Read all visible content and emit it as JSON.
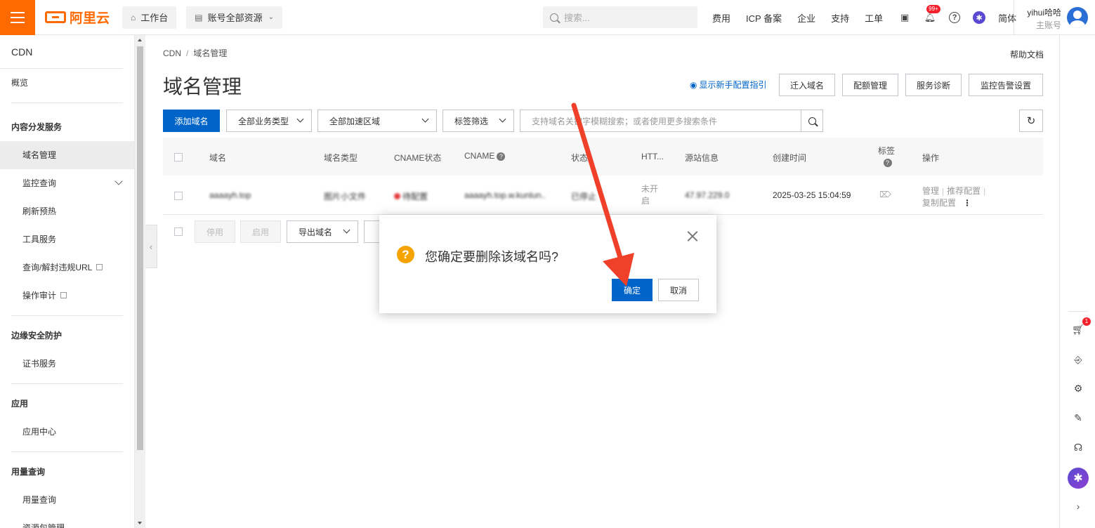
{
  "topbar": {
    "brand": "阿里云",
    "workbench": "工作台",
    "resource_scope": "账号全部资源",
    "search_placeholder": "搜索...",
    "links": [
      "费用",
      "ICP 备案",
      "企业",
      "支持",
      "工单"
    ],
    "notification_badge": "99+",
    "language": "简体",
    "user_name": "yihui哈哈",
    "user_role": "主账号"
  },
  "sidebar": {
    "title": "CDN",
    "overview": "概览",
    "groups": [
      {
        "label": "内容分发服务",
        "items": [
          "域名管理",
          "监控查询",
          "刷新预热",
          "工具服务",
          "查询/解封违规URL",
          "操作审计"
        ]
      },
      {
        "label": "边缘安全防护",
        "items": [
          "证书服务"
        ]
      },
      {
        "label": "应用",
        "items": [
          "应用中心"
        ]
      },
      {
        "label": "用量查询",
        "items": [
          "用量查询",
          "资源包管理"
        ]
      }
    ]
  },
  "main": {
    "breadcrumb": [
      "CDN",
      "域名管理"
    ],
    "help_doc": "帮助文档",
    "title": "域名管理",
    "guide_link": "显示新手配置指引",
    "top_buttons": [
      "迁入域名",
      "配额管理",
      "服务诊断",
      "监控告警设置"
    ],
    "add_domain": "添加域名",
    "filters": [
      "全部业务类型",
      "全部加速区域",
      "标签筛选"
    ],
    "search_placeholder": "支持域名关键字模糊搜索；或者使用更多搜索条件",
    "columns": [
      "域名",
      "域名类型",
      "CNAME状态",
      "CNAME",
      "状态",
      "HTT...",
      "源站信息",
      "创建时间",
      "标签",
      "操作"
    ],
    "row": {
      "domain": "aaaayh.top",
      "type": "图片小文件",
      "cname_status": "待配置",
      "cname": "aaaayh.top.w.kunlun...",
      "status": "已停止",
      "https": "未开启",
      "origin": "47.97.229.0",
      "created": "2025-03-25 15:04:59",
      "ops": [
        "管理",
        "推荐配置",
        "复制配置"
      ]
    },
    "bulk": {
      "disable": "停用",
      "enable": "启用",
      "export": "导出域名"
    }
  },
  "modal": {
    "message": "您确定要删除该域名吗?",
    "ok": "确定",
    "cancel": "取消"
  },
  "right_rail": {
    "cart_badge": "1"
  },
  "colors": {
    "brand_orange": "#ff6a00",
    "primary_blue": "#0064c8",
    "warning": "#f5a300",
    "annotation_red": "#f0402a"
  }
}
